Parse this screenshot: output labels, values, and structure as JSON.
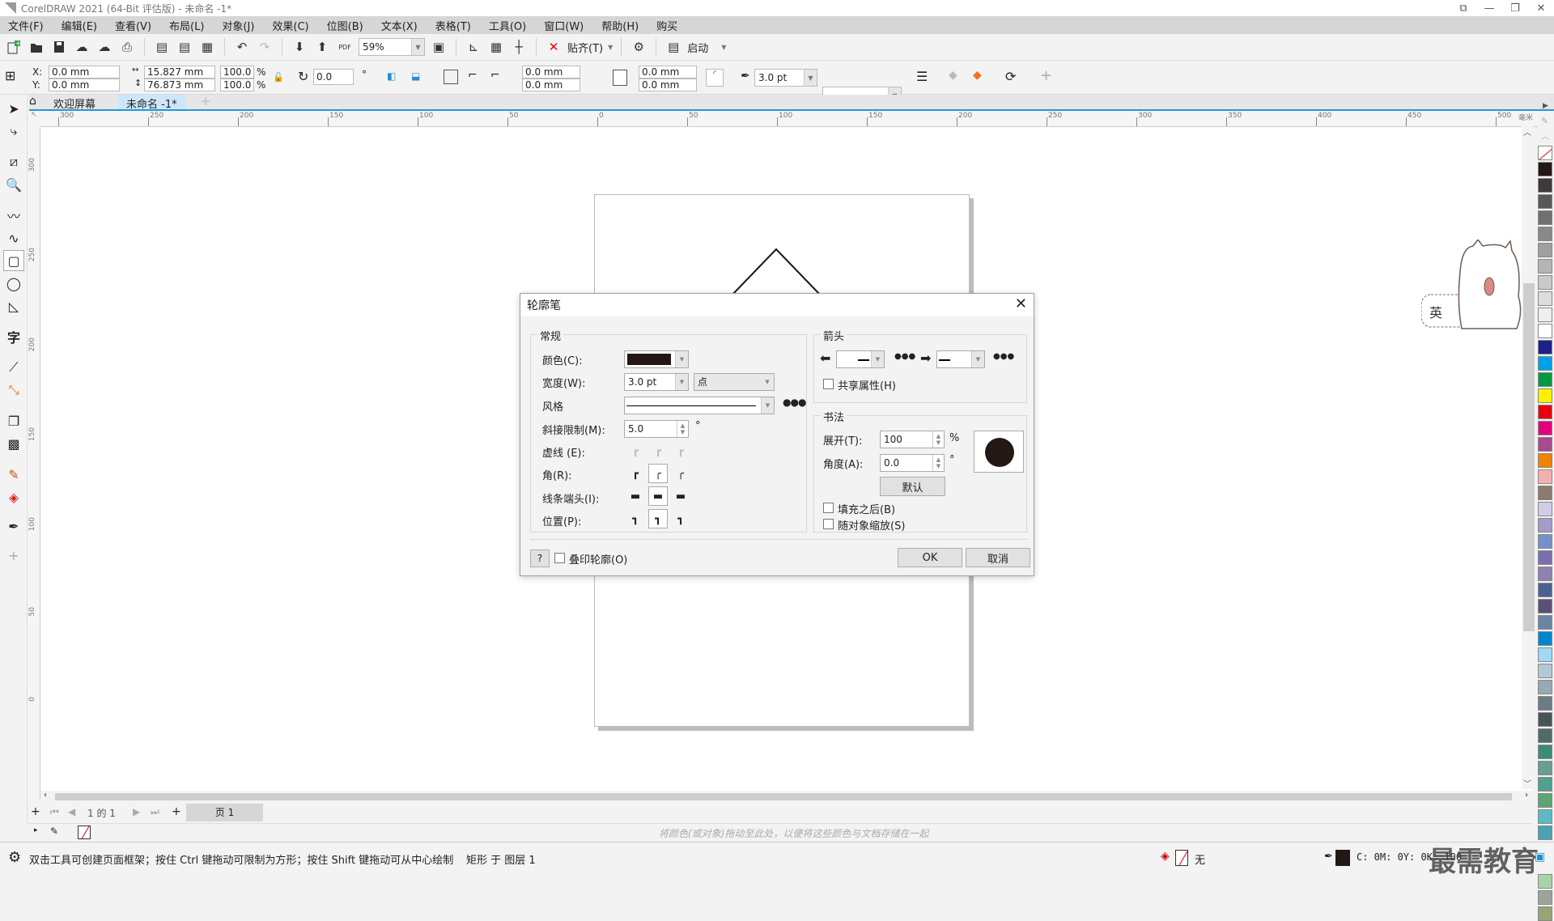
{
  "window": {
    "title": "CorelDRAW 2021 (64-Bit 评估版) - 未命名 -1*"
  },
  "menu": [
    "文件(F)",
    "编辑(E)",
    "查看(V)",
    "布局(L)",
    "对象(J)",
    "效果(C)",
    "位图(B)",
    "文本(X)",
    "表格(T)",
    "工具(O)",
    "窗口(W)",
    "帮助(H)",
    "购买"
  ],
  "toolbar": {
    "zoom": "59%",
    "snap_label": "贴齐(T)",
    "launch_label": "启动"
  },
  "propbar": {
    "x_label": "X:",
    "y_label": "Y:",
    "x": "0.0 mm",
    "y": "0.0 mm",
    "width": "15.827 mm",
    "height": "76.873 mm",
    "scale_w": "100.0",
    "scale_h": "100.0",
    "pct": "%",
    "rotation": "0.0",
    "deg": "°",
    "corner_tl": "0.0 mm",
    "corner_bl": "0.0 mm",
    "corner_tr": "0.0 mm",
    "corner_br": "0.0 mm",
    "outline_width": "3.0 pt"
  },
  "tabs": [
    {
      "label": "欢迎屏幕",
      "active": false
    },
    {
      "label": "未命名 -1*",
      "active": true
    }
  ],
  "ruler": {
    "h_ticks": [
      "300",
      "250",
      "200",
      "150",
      "100",
      "50",
      "0",
      "50",
      "100",
      "150",
      "200",
      "250",
      "300",
      "350",
      "400",
      "450",
      "500"
    ],
    "unit": "毫米",
    "v_ticks": [
      "300",
      "250",
      "200",
      "150",
      "100",
      "50",
      "0"
    ]
  },
  "dialog": {
    "title": "轮廓笔",
    "general": {
      "group_title": "常规",
      "color_label": "颜色(C):",
      "color_value": "#231815",
      "width_label": "宽度(W):",
      "width_value": "3.0 pt",
      "width_unit": "点",
      "style_label": "风格",
      "miter_label": "斜接限制(M):",
      "miter_value": "5.0",
      "miter_unit": "°",
      "dash_label": "虚线 (E):",
      "corner_label": "角(R):",
      "cap_label": "线条端头(I):",
      "position_label": "位置(P):"
    },
    "arrows": {
      "group_title": "箭头",
      "share_label": "共享属性(H)",
      "share_checked": false
    },
    "calligraphy": {
      "group_title": "书法",
      "stretch_label": "展开(T):",
      "stretch_value": "100",
      "stretch_unit": "%",
      "angle_label": "角度(A):",
      "angle_value": "0.0",
      "angle_unit": "°",
      "default_label": "默认",
      "behind_fill_label": "填充之后(B)",
      "behind_fill_checked": false,
      "scale_label": "随对象缩放(S)",
      "scale_checked": false
    },
    "help_label": "?",
    "overprint_label": "叠印轮廓(O)",
    "overprint_checked": false,
    "ok_label": "OK",
    "cancel_label": "取消"
  },
  "pagebar": {
    "page_info": "1 的 1",
    "page_tab": "页 1"
  },
  "colorbar": {
    "hint": "将颜色(或对象)拖动至此处，以便将这些颜色与文档存储在一起"
  },
  "status": {
    "hint": "双击工具可创建页面框架；按住 Ctrl 键拖动可限制为方形；按住 Shift 键拖动可从中心绘制",
    "object_info": "矩形 于 图层 1",
    "fill": "无",
    "outline_color": "C: 0M: 0Y: 0K: 100"
  },
  "palette": [
    "#231815",
    "#3e3a39",
    "#595757",
    "#727171",
    "#898989",
    "#9fa0a0",
    "#b5b5b6",
    "#c9caca",
    "#dcdddd",
    "#efefef",
    "#ffffff",
    "#1d2088",
    "#00a0e9",
    "#009944",
    "#fff100",
    "#e60012",
    "#e4007f",
    "#a84b8c",
    "#f08300",
    "#f2b1b1",
    "#8a7a70",
    "#d1cde6",
    "#a59aca",
    "#7591c9",
    "#7b6eb0",
    "#8f82b0",
    "#4b6090",
    "#5a5176",
    "#6b86a3",
    "#0086d1",
    "#a0d8f5",
    "#b2c9d8",
    "#98a9b2",
    "#6d7b84",
    "#4a5356",
    "#4f6b6b",
    "#3e8a78",
    "#6a9c95",
    "#4ea28e",
    "#5da574",
    "#5bbac8",
    "#4aa3b0",
    "#b9cbb9",
    "#d4e9d4",
    "#a7d3a8",
    "#9aa69a",
    "#97a574"
  ],
  "watermark": "最需教育",
  "ime": {
    "label": "英"
  }
}
